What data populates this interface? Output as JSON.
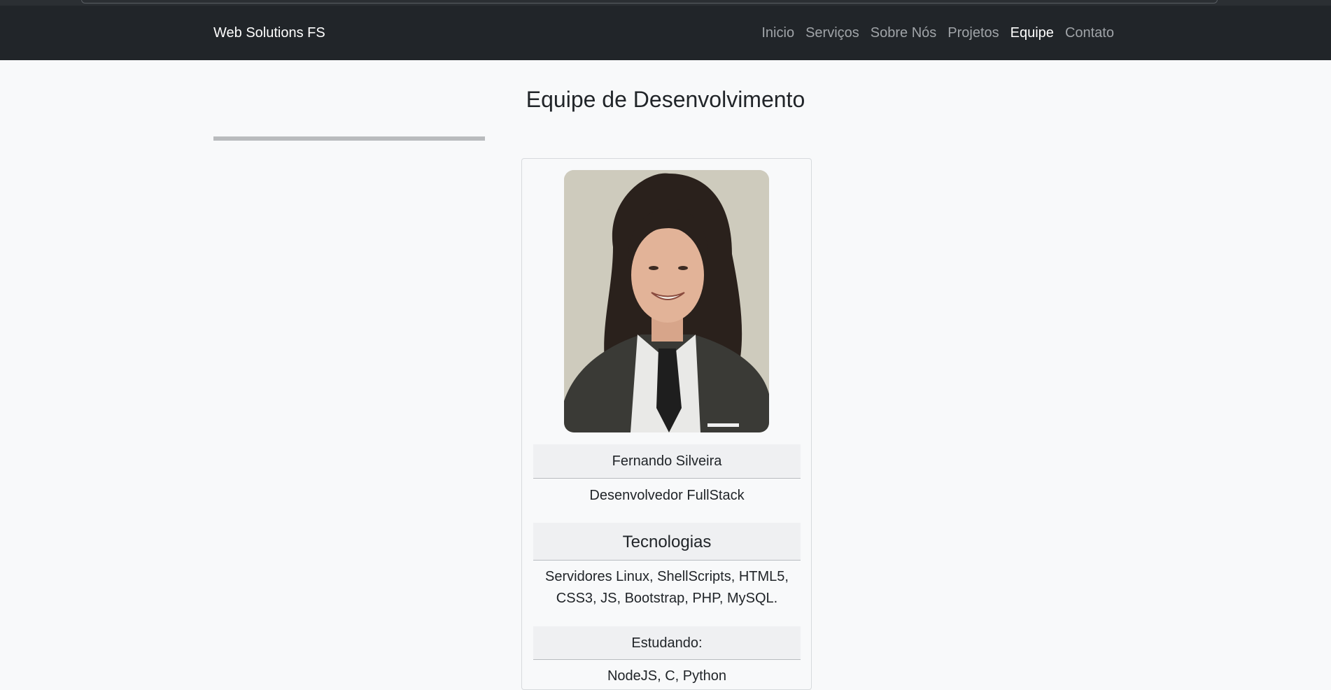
{
  "navbar": {
    "brand": "Web Solutions FS",
    "links": [
      {
        "label": "Inicio",
        "active": false
      },
      {
        "label": "Serviços",
        "active": false
      },
      {
        "label": "Sobre Nós",
        "active": false
      },
      {
        "label": "Projetos",
        "active": false
      },
      {
        "label": "Equipe",
        "active": true
      },
      {
        "label": "Contato",
        "active": false
      }
    ]
  },
  "page": {
    "title": "Equipe de Desenvolvimento"
  },
  "member": {
    "name": "Fernando Silveira",
    "role": "Desenvolvedor FullStack",
    "tech_heading": "Tecnologias",
    "tech_list": "Servidores Linux, ShellScripts, HTML5, CSS3, JS, Bootstrap, PHP, MySQL.",
    "study_heading": "Estudando:",
    "study_list": "NodeJS, C, Python"
  }
}
